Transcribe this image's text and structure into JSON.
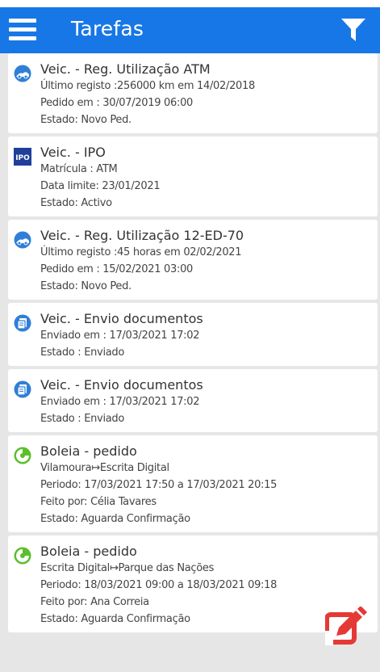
{
  "header": {
    "title": "Tarefas",
    "menu_icon": "hamburger-menu-icon",
    "filter_icon": "filter-icon",
    "bar_color": "#1877e6"
  },
  "tasks": [
    {
      "icon": "vehicle-usage-icon",
      "title": "Veic. - Reg. Utilização ATM",
      "lines": [
        "Último registo :256000 km em 14/02/2018",
        "Pedido em :  30/07/2019 06:00",
        "Estado:  Novo Ped."
      ]
    },
    {
      "icon": "ipo-icon",
      "title": "Veic. - IPO",
      "lines": [
        "Matrícula : ATM",
        "Data limite:  23/01/2021",
        "Estado:  Activo"
      ]
    },
    {
      "icon": "vehicle-usage-icon",
      "title": "Veic. - Reg. Utilização 12-ED-70",
      "lines": [
        "Último registo :45 horas em 02/02/2021",
        "Pedido em :  15/02/2021 03:00",
        "Estado:  Novo Ped."
      ]
    },
    {
      "icon": "documents-icon",
      "title": "Veic. - Envio documentos",
      "lines": [
        "Enviado em :  17/03/2021 17:02",
        "Estado :  Enviado"
      ]
    },
    {
      "icon": "documents-icon",
      "title": "Veic. - Envio documentos",
      "lines": [
        "Enviado em :  17/03/2021 17:02",
        "Estado :  Enviado"
      ]
    },
    {
      "icon": "ride-request-icon",
      "title": "Boleia - pedido",
      "lines": [
        "Vilamoura↦Escrita Digital",
        "Periodo:  17/03/2021 17:50 a  17/03/2021 20:15",
        "Feito por:  Célia Tavares",
        "Estado:  Aguarda Confirmação"
      ]
    },
    {
      "icon": "ride-request-icon",
      "title": "Boleia - pedido",
      "lines": [
        "Escrita Digital↦Parque das Nações",
        "Periodo:  18/03/2021 09:00 a  18/03/2021 09:18",
        "Feito por:  Ana Correia",
        "Estado:  Aguarda Confirmação"
      ]
    }
  ],
  "fab": {
    "icon": "edit-icon",
    "color": "#e53935"
  }
}
